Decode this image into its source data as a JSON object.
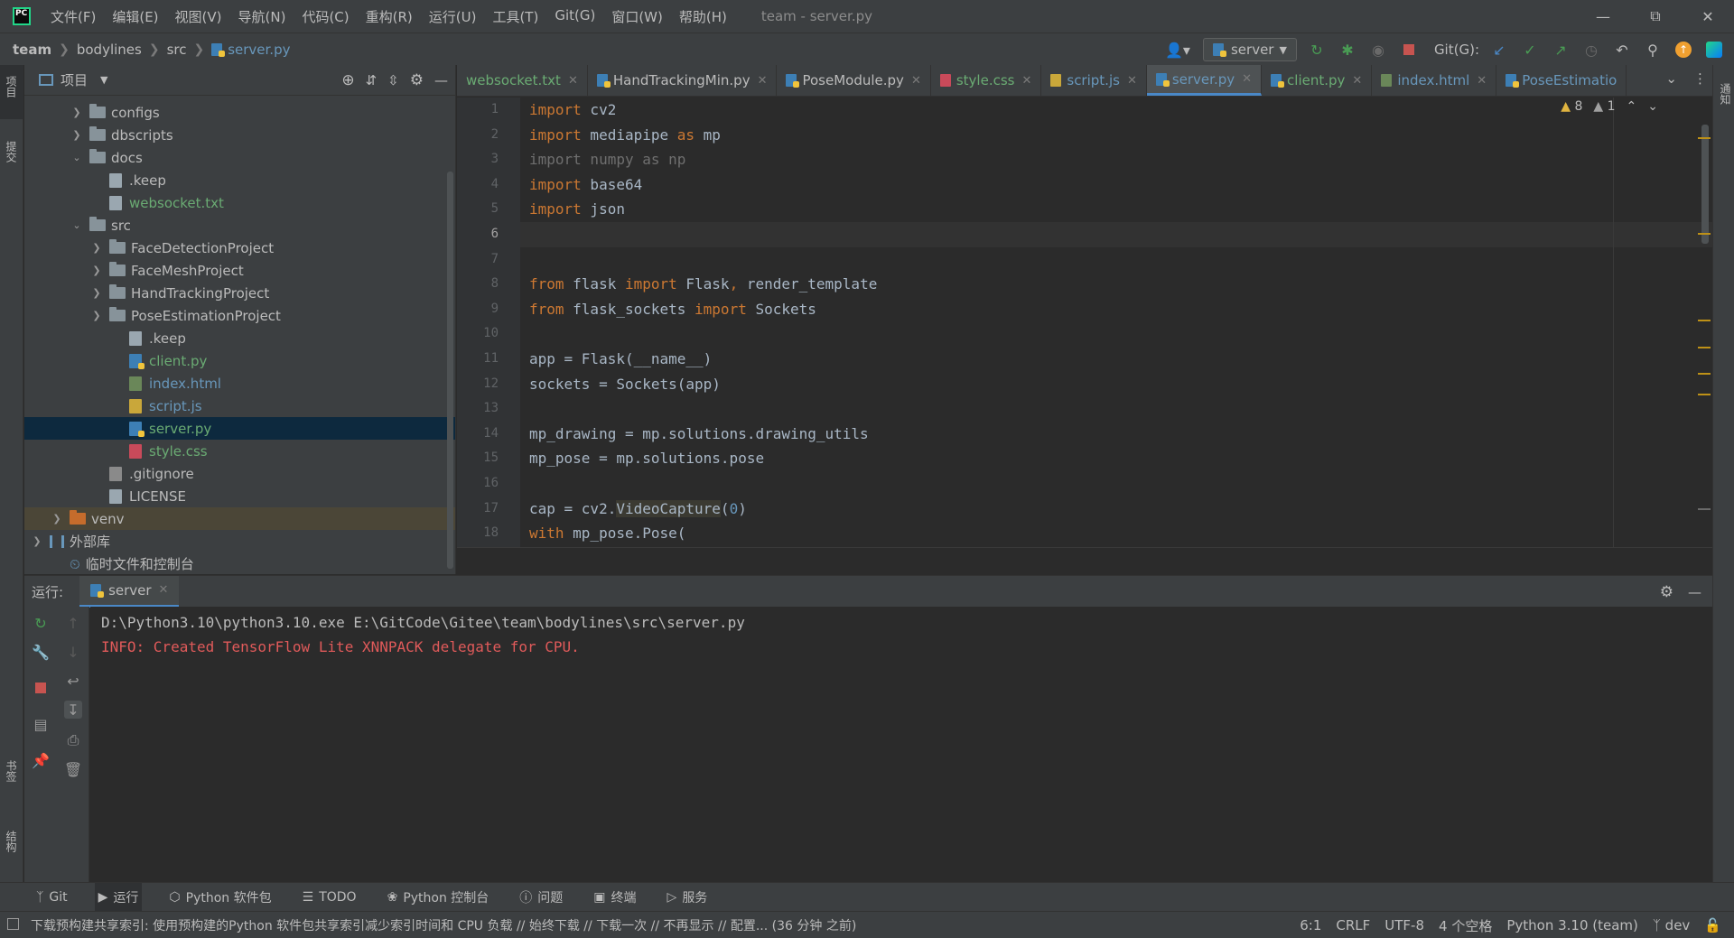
{
  "menubar": {
    "items": [
      "文件(F)",
      "编辑(E)",
      "视图(V)",
      "导航(N)",
      "代码(C)",
      "重构(R)",
      "运行(U)",
      "工具(T)",
      "Git(G)",
      "窗口(W)",
      "帮助(H)"
    ],
    "window_title": "team - server.py"
  },
  "breadcrumb": [
    "team",
    "bodylines",
    "src",
    "server.py"
  ],
  "toolbar": {
    "run_config": "server",
    "git_label": "Git(G):"
  },
  "left_stripe": {
    "project": "项目",
    "commit": "提交",
    "bookmarks": "书签",
    "structure": "结构"
  },
  "right_stripe": {
    "notifications": "通知"
  },
  "project_panel": {
    "title": "项目",
    "tree": [
      {
        "label": "configs",
        "type": "folder",
        "depth": 2,
        "expanded": false
      },
      {
        "label": "dbscripts",
        "type": "folder",
        "depth": 2,
        "expanded": false
      },
      {
        "label": "docs",
        "type": "folder",
        "depth": 2,
        "expanded": true
      },
      {
        "label": ".keep",
        "type": "file",
        "depth": 3
      },
      {
        "label": "websocket.txt",
        "type": "file",
        "depth": 3,
        "color": "green"
      },
      {
        "label": "src",
        "type": "folder",
        "depth": 2,
        "expanded": true
      },
      {
        "label": "FaceDetectionProject",
        "type": "folder",
        "depth": 3,
        "expanded": false
      },
      {
        "label": "FaceMeshProject",
        "type": "folder",
        "depth": 3,
        "expanded": false
      },
      {
        "label": "HandTrackingProject",
        "type": "folder",
        "depth": 3,
        "expanded": false
      },
      {
        "label": "PoseEstimationProject",
        "type": "folder",
        "depth": 3,
        "expanded": false
      },
      {
        "label": ".keep",
        "type": "file",
        "depth": 4
      },
      {
        "label": "client.py",
        "type": "py",
        "depth": 4,
        "color": "green"
      },
      {
        "label": "index.html",
        "type": "html",
        "depth": 4,
        "color": "blue"
      },
      {
        "label": "script.js",
        "type": "js",
        "depth": 4,
        "color": "blue"
      },
      {
        "label": "server.py",
        "type": "py",
        "depth": 4,
        "color": "green",
        "selected": true
      },
      {
        "label": "style.css",
        "type": "css",
        "depth": 4,
        "color": "green"
      },
      {
        "label": ".gitignore",
        "type": "git",
        "depth": 3
      },
      {
        "label": "LICENSE",
        "type": "file",
        "depth": 3
      },
      {
        "label": "venv",
        "type": "folder-orange",
        "depth": 1,
        "expanded": false
      },
      {
        "label": "外部库",
        "type": "lib",
        "depth": 0,
        "expanded": false
      },
      {
        "label": "临时文件和控制台",
        "type": "scratch",
        "depth": 1
      }
    ]
  },
  "editor_tabs": [
    {
      "label": "websocket.txt",
      "icon": "none",
      "color": "green"
    },
    {
      "label": "HandTrackingMin.py",
      "icon": "py",
      "color": "normal"
    },
    {
      "label": "PoseModule.py",
      "icon": "py",
      "color": "normal"
    },
    {
      "label": "style.css",
      "icon": "css",
      "color": "green"
    },
    {
      "label": "script.js",
      "icon": "js",
      "color": "blue"
    },
    {
      "label": "server.py",
      "icon": "py",
      "color": "blue",
      "active": true
    },
    {
      "label": "client.py",
      "icon": "py",
      "color": "green"
    },
    {
      "label": "index.html",
      "icon": "html",
      "color": "blue"
    },
    {
      "label": "PoseEstimatio",
      "icon": "py",
      "color": "blue"
    }
  ],
  "editor": {
    "warnings": "8",
    "weak_warnings": "1",
    "current_line": 6,
    "lines": [
      [
        [
          "kw",
          "import"
        ],
        [
          "",
          " cv2"
        ]
      ],
      [
        [
          "kw",
          "import"
        ],
        [
          "",
          " mediapipe "
        ],
        [
          "kw",
          "as"
        ],
        [
          "",
          " mp"
        ]
      ],
      [
        [
          "dim",
          "import numpy as np"
        ]
      ],
      [
        [
          "kw",
          "import"
        ],
        [
          "",
          " base64"
        ]
      ],
      [
        [
          "kw",
          "import"
        ],
        [
          "",
          " json"
        ]
      ],
      [],
      [],
      [
        [
          "kw",
          "from"
        ],
        [
          "",
          " flask "
        ],
        [
          "kw",
          "import"
        ],
        [
          "",
          " Flask"
        ],
        [
          "kw",
          ","
        ],
        [
          "",
          " render_template"
        ]
      ],
      [
        [
          "kw",
          "from"
        ],
        [
          "",
          " flask_sockets "
        ],
        [
          "kw",
          "import"
        ],
        [
          "",
          " Sockets"
        ]
      ],
      [],
      [
        [
          "",
          "app = Flask(__name__)"
        ]
      ],
      [
        [
          "",
          "sockets = Sockets(app)"
        ]
      ],
      [],
      [
        [
          "",
          "mp_drawing = mp.solutions.drawing_utils"
        ]
      ],
      [
        [
          "",
          "mp_pose = mp.solutions.pose"
        ]
      ],
      [],
      [
        [
          "",
          "cap = cv2."
        ],
        [
          "hl",
          "VideoCapture"
        ],
        [
          "",
          "("
        ],
        [
          "num",
          "0"
        ],
        [
          "",
          ")"
        ]
      ],
      [
        [
          "kw",
          "with"
        ],
        [
          "",
          " mp_pose.Pose("
        ]
      ]
    ]
  },
  "run_panel": {
    "label": "运行:",
    "tab": "server",
    "console": [
      {
        "type": "cmd",
        "text": "D:\\Python3.10\\python3.10.exe E:\\GitCode\\Gitee\\team\\bodylines\\src\\server.py"
      },
      {
        "type": "err",
        "text": "INFO: Created TensorFlow Lite XNNPACK delegate for CPU."
      }
    ]
  },
  "bottom_tools": [
    {
      "label": "Git",
      "icon": "branch-icon"
    },
    {
      "label": "运行",
      "icon": "play-icon",
      "active": true
    },
    {
      "label": "Python 软件包",
      "icon": "package-icon"
    },
    {
      "label": "TODO",
      "icon": "list-icon"
    },
    {
      "label": "Python 控制台",
      "icon": "python-icon"
    },
    {
      "label": "问题",
      "icon": "info-icon"
    },
    {
      "label": "终端",
      "icon": "terminal-icon"
    },
    {
      "label": "服务",
      "icon": "services-icon"
    }
  ],
  "statusbar": {
    "message": "下载预构建共享索引: 使用预构建的Python 软件包共享索引减少索引时间和 CPU 负载 // 始终下载 // 下载一次 // 不再显示 // 配置... (36 分钟 之前)",
    "position": "6:1",
    "line_sep": "CRLF",
    "encoding": "UTF-8",
    "indent": "4 个空格",
    "interpreter": "Python 3.10 (team)",
    "branch": "dev"
  },
  "colors": {
    "accent": "#4a88c7",
    "keyword": "#cc7832",
    "error_text": "#e05a5a",
    "vcs_added": "#6aab73",
    "vcs_modified": "#6897bb"
  }
}
